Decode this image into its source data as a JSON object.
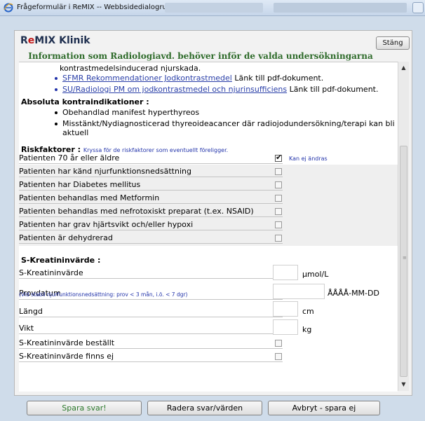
{
  "window": {
    "title": "Frågeformulär i ReMIX -- Webbsidedialogruta"
  },
  "dialog": {
    "brand_prefix": "R",
    "brand_e": "e",
    "brand_rest": "MIX Klinik",
    "close_label": "Stäng",
    "subtitle": "Information som Radiologiavd. behöver inför de valda undersökningarna"
  },
  "info": {
    "partial_line": "kontrastmedelsinducerad njurskada.",
    "links": [
      {
        "text": "SFMR Rekommendationer Jodkontrastmedel",
        "suffix": " Länk till pdf-dokument."
      },
      {
        "text": "SU/Radiologi PM om jodkontrastmedel och njurinsufficiens",
        "suffix": " Länk till pdf-dokument."
      }
    ],
    "contra_heading": "Absoluta kontraindikationer :",
    "contra_items": [
      "Obehandlad manifest hyperthyreos",
      "Misstänkt/Nydiagnosticerad thyreoideacancer där radiojodundersökning/terapi kan bli",
      "aktuell"
    ]
  },
  "risk": {
    "heading": "Riskfaktorer :",
    "note": "Kryssa för de riskfaktorer som eventuellt föreligger.",
    "locked_note": "Kan ej ändras",
    "items": [
      {
        "label": "Patienten 70 år eller äldre",
        "checked": true
      },
      {
        "label": "Patienten har känd njurfunktionsnedsättning",
        "checked": false
      },
      {
        "label": "Patienten har Diabetes mellitus",
        "checked": false
      },
      {
        "label": "Patienten behandlas med Metformin",
        "checked": false
      },
      {
        "label": "Patienten behandlas med nefrotoxiskt preparat (t.ex. NSAID)",
        "checked": false
      },
      {
        "label": "Patienten har grav hjärtsvikt och/eller hypoxi",
        "checked": false
      },
      {
        "label": "Patienten är dehydrerad",
        "checked": false
      }
    ]
  },
  "kreatinin": {
    "heading": "S-Kreatininvärde :",
    "value_label": "S-Kreatininvärde",
    "value_unit": "µmol/L",
    "date_label": "Provdatum",
    "date_note": "(Vid stabil njurfunktionsnedsättning: prov < 3 mån, i.ö. < 7 dgr)",
    "date_format": "ÅÅÅÅ-MM-DD",
    "length_label": "Längd",
    "length_unit": "cm",
    "weight_label": "Vikt",
    "weight_unit": "kg",
    "ordered_label": "S-Kreatininvärde beställt",
    "missing_label": "S-Kreatininvärde finns ej"
  },
  "buttons": {
    "save": "Spara svar!",
    "clear": "Radera svar/värden",
    "cancel": "Avbryt - spara ej"
  }
}
